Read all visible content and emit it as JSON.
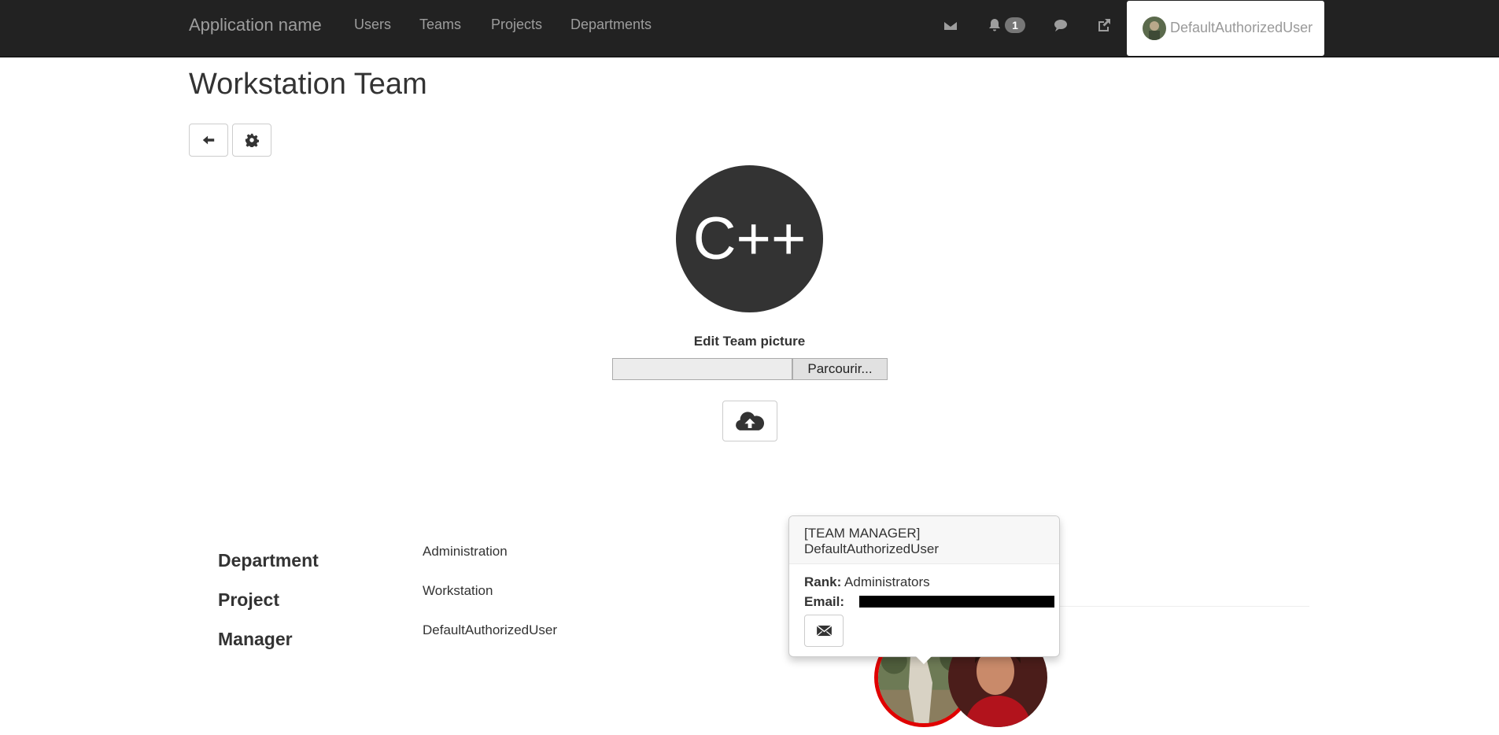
{
  "navbar": {
    "brand": "Application name",
    "links": [
      "Users",
      "Teams",
      "Projects",
      "Departments"
    ],
    "icons": [
      "envelope-icon",
      "bell-icon",
      "comment-icon",
      "share-icon"
    ],
    "notification_count": "1",
    "user": "DefaultAuthorizedUser"
  },
  "page": {
    "title": "Workstation Team",
    "back_icon": "arrow-left-icon",
    "settings_icon": "gear-icon"
  },
  "team_picture": {
    "initials": "C++",
    "edit_label": "Edit Team picture",
    "browse_label": "Parcourir...",
    "upload_icon": "cloud-upload-icon"
  },
  "details": [
    {
      "label": "Department",
      "value": "Administration"
    },
    {
      "label": "Project",
      "value": "Workstation"
    },
    {
      "label": "Manager",
      "value": "DefaultAuthorizedUser"
    }
  ],
  "popover": {
    "title_line1": "[TEAM MANAGER]",
    "title_line2": "DefaultAuthorizedUser",
    "rank_label": "Rank:",
    "rank_value": "Administrators",
    "email_label": "Email:",
    "email_icon": "envelope-icon"
  },
  "colors": {
    "navbar_bg": "#222222",
    "manager_ring": "#e00000",
    "team_circle": "#333333"
  }
}
